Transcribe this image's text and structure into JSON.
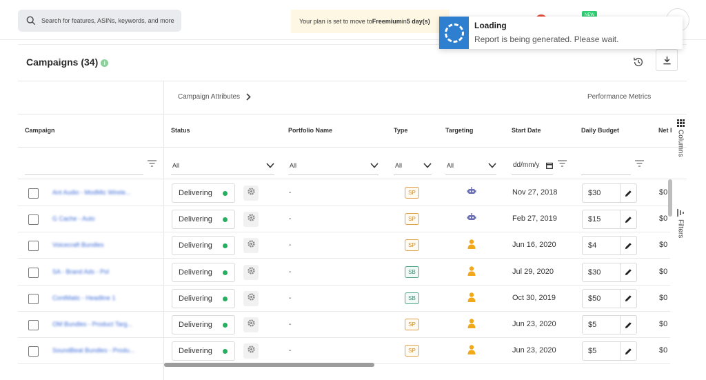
{
  "search": {
    "placeholder": "Search for features, ASINs, keywords, and more"
  },
  "plan_banner": {
    "prefix": "Your plan is set to move to ",
    "plan": "Freemium",
    "middle": " in ",
    "days": "5 day(s)"
  },
  "header_badges": {
    "new": "NEW"
  },
  "toast": {
    "title": "Loading",
    "message": "Report is being generated. Please wait."
  },
  "campaigns": {
    "title": "Campaigns (34)",
    "info_icon": "info-icon"
  },
  "groups": {
    "attributes": "Campaign Attributes",
    "performance": "Performance Metrics"
  },
  "columns": {
    "campaign": "Campaign",
    "status": "Status",
    "portfolio": "Portfolio Name",
    "type": "Type",
    "targeting": "Targeting",
    "start_date": "Start Date",
    "daily_budget": "Daily Budget",
    "net": "Net I"
  },
  "filters": {
    "status": "All",
    "portfolio": "All",
    "type": "All",
    "targeting": "All",
    "date_placeholder": "dd/mm/y"
  },
  "side_tabs": {
    "columns": "Columns",
    "filters": "Filters"
  },
  "rows": [
    {
      "name": "Ant Audio - ModMic Wirele...",
      "status": "Delivering",
      "portfolio": "-",
      "type": "SP",
      "targeting": "robot-icon",
      "start_date": "Nov 27, 2018",
      "budget": "$30",
      "net": "$0"
    },
    {
      "name": "G Cache - Auto",
      "status": "Delivering",
      "portfolio": "-",
      "type": "SP",
      "targeting": "robot-icon",
      "start_date": "Feb 27, 2019",
      "budget": "$15",
      "net": "$0"
    },
    {
      "name": "Voicecraft Bundles",
      "status": "Delivering",
      "portfolio": "-",
      "type": "SP",
      "targeting": "person-icon",
      "start_date": "Jun 16, 2020",
      "budget": "$4",
      "net": "$0"
    },
    {
      "name": "SA - Brand Ads - Pol",
      "status": "Delivering",
      "portfolio": "-",
      "type": "SB",
      "targeting": "person-icon",
      "start_date": "Jul 29, 2020",
      "budget": "$30",
      "net": "$0"
    },
    {
      "name": "ContMatic - Headline 1",
      "status": "Delivering",
      "portfolio": "-",
      "type": "SB",
      "targeting": "person-icon",
      "start_date": "Oct 30, 2019",
      "budget": "$50",
      "net": "$0"
    },
    {
      "name": "OM Bundles - Product Targ...",
      "status": "Delivering",
      "portfolio": "-",
      "type": "SP",
      "targeting": "person-icon",
      "start_date": "Jun 23, 2020",
      "budget": "$5",
      "net": "$0"
    },
    {
      "name": "SoundBeat Bundles - Produ...",
      "status": "Delivering",
      "portfolio": "-",
      "type": "SP",
      "targeting": "person-icon",
      "start_date": "Jun 23, 2020",
      "budget": "$5",
      "net": "$0"
    }
  ],
  "colors": {
    "delivering": "#27ae60",
    "sp": "#d08a2c",
    "sb": "#3c8b73",
    "robot": "#6a6fb5",
    "person": "#f1a81b",
    "toast_accent": "#2f7fd1"
  }
}
